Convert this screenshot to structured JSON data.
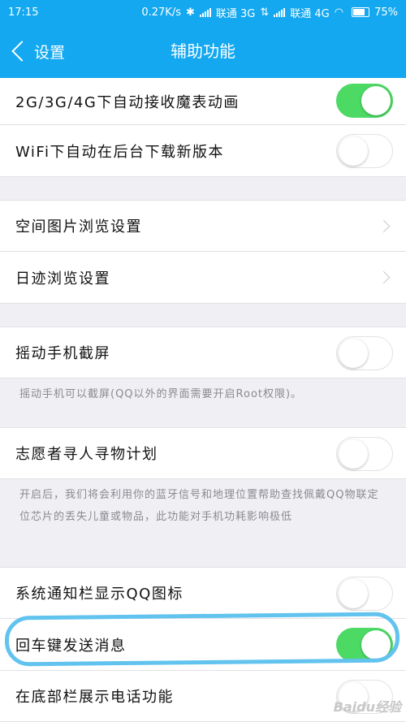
{
  "status_bar": {
    "time": "17:15",
    "speed": "0.27K/s",
    "carrier1": "联通 3G",
    "carrier2": "联通 4G",
    "battery": "75%"
  },
  "nav": {
    "back_label": "设置",
    "title": "辅助功能"
  },
  "rows": {
    "auto_receive": {
      "label": "2G/3G/4G下自动接收魔表动画",
      "checked": true
    },
    "wifi_download": {
      "label": "WiFi下自动在后台下载新版本",
      "checked": false
    },
    "photo_browse": {
      "label": "空间图片浏览设置"
    },
    "trace_browse": {
      "label": "日迹浏览设置"
    },
    "shake_screenshot": {
      "label": "摇动手机截屏",
      "checked": false,
      "description": "摇动手机可以截屏(QQ以外的界面需要开启Root权限)。"
    },
    "volunteer": {
      "label": "志愿者寻人寻物计划",
      "checked": false,
      "description": "开启后，我们将会利用你的蓝牙信号和地理位置帮助查找佩戴QQ物联定位芯片的丢失儿童或物品，此功能对手机功耗影响极低"
    },
    "notify_icon": {
      "label": "系统通知栏显示QQ图标",
      "checked": false
    },
    "enter_send": {
      "label": "回车键发送消息",
      "checked": true
    },
    "bottom_phone": {
      "label": "在底部栏展示电话功能",
      "checked": false
    }
  },
  "watermark": "Baidu经验",
  "colors": {
    "accent": "#13a8f0",
    "toggle_on": "#4cd964",
    "highlight": "#61c3ee"
  }
}
